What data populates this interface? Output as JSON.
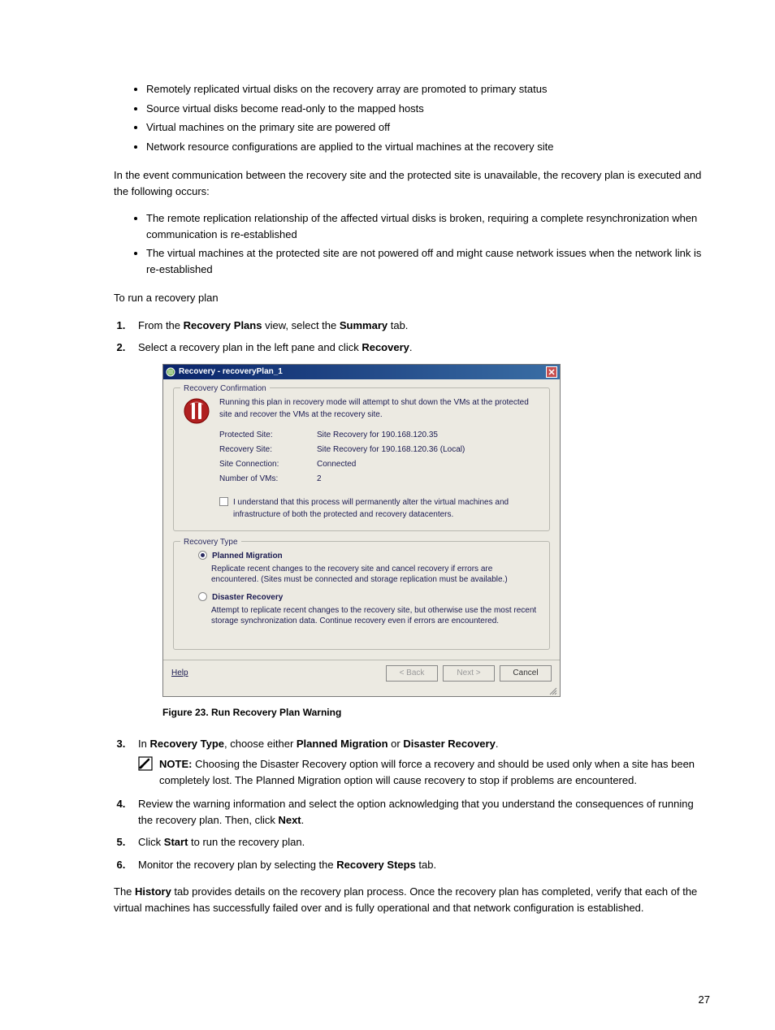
{
  "bullets_top": [
    "Remotely replicated virtual disks on the recovery array are promoted to primary status",
    "Source virtual disks become read-only to the mapped hosts",
    "Virtual machines on the primary site are powered off",
    "Network resource configurations are applied to the virtual machines at the recovery site"
  ],
  "para_event": "In the event communication between the recovery site and the protected site is unavailable, the recovery plan is executed and the following occurs:",
  "bullets_event": [
    "The remote replication relationship of the affected virtual disks is broken, requiring a complete resynchronization when communication is re-established",
    "The virtual machines at the protected site are not powered off and might cause network issues when the network link is re-established"
  ],
  "para_torun": "To run a recovery plan",
  "steps_1_2": {
    "s1_pre": "From the ",
    "s1_b1": "Recovery Plans",
    "s1_mid": " view, select the ",
    "s1_b2": "Summary",
    "s1_post": " tab.",
    "s2_pre": "Select a recovery plan in the left pane and click ",
    "s2_b1": "Recovery",
    "s2_post": "."
  },
  "dialog": {
    "title": "Recovery - recoveryPlan_1",
    "confirm_legend": "Recovery Confirmation",
    "confirm_intro": "Running this plan in recovery mode will attempt to shut down the VMs at the protected site and recover the VMs at the recovery site.",
    "labels": {
      "protected": "Protected Site:",
      "recovery": "Recovery Site:",
      "conn": "Site Connection:",
      "numvm": "Number of VMs:"
    },
    "values": {
      "protected": "Site Recovery for 190.168.120.35",
      "recovery": "Site Recovery for 190.168.120.36 (Local)",
      "conn": "Connected",
      "numvm": "2"
    },
    "ack": "I understand that this process will permanently alter the virtual machines and infrastructure of both the protected and recovery datacenters.",
    "type_legend": "Recovery Type",
    "planned_label": "Planned Migration",
    "planned_desc": "Replicate recent changes to the recovery site and cancel recovery if errors are encountered. (Sites must be connected and storage replication must be available.)",
    "disaster_label": "Disaster Recovery",
    "disaster_desc": "Attempt to replicate recent changes to the recovery site, but otherwise use the most recent storage synchronization data. Continue recovery even if errors are encountered.",
    "footer": {
      "help": "Help",
      "back": "< Back",
      "next": "Next >",
      "cancel": "Cancel"
    }
  },
  "figure_caption": "Figure 23. Run Recovery Plan Warning",
  "step3": {
    "pre": "In ",
    "b1": "Recovery Type",
    "mid1": ", choose either ",
    "b2": "Planned Migration",
    "mid2": " or ",
    "b3": "Disaster Recovery",
    "post": "."
  },
  "note": {
    "label": "NOTE: ",
    "text": "Choosing the Disaster Recovery option will force a recovery and should be used only when a site has been completely lost. The Planned Migration option will cause recovery to stop if problems are encountered."
  },
  "step4": {
    "pre": "Review the warning information and select the option acknowledging that you understand the consequences of running the recovery plan. Then, click ",
    "b1": "Next",
    "post": "."
  },
  "step5": {
    "pre": "Click ",
    "b1": "Start",
    "post": " to run the recovery plan."
  },
  "step6": {
    "pre": "Monitor the recovery plan by selecting the ",
    "b1": "Recovery Steps",
    "post": " tab."
  },
  "para_history": {
    "pre": "The ",
    "b1": "History",
    "post": " tab provides details on the recovery plan process. Once the recovery plan has completed, verify that each of the virtual machines has successfully failed over and is fully operational and that network configuration is established."
  },
  "page_number": "27"
}
